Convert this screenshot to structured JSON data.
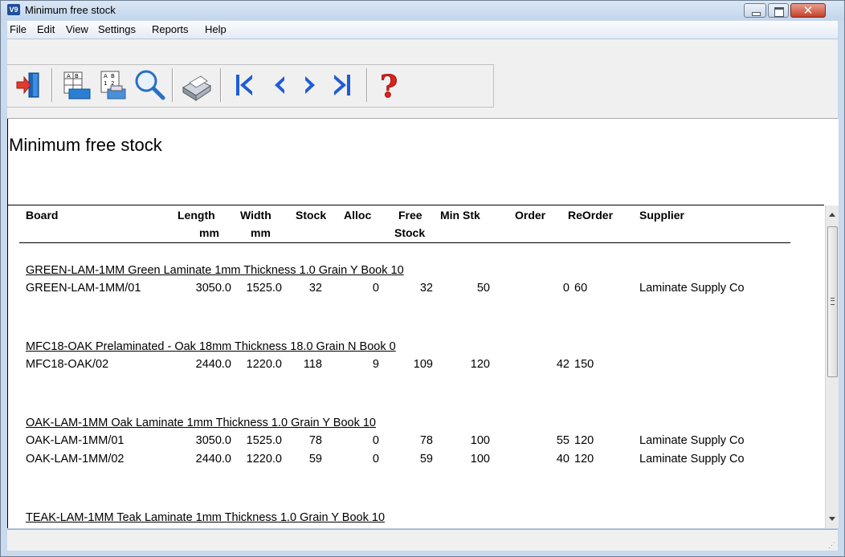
{
  "window": {
    "title": "Minimum free stock",
    "app_icon": "V9"
  },
  "menu": [
    "File",
    "Edit",
    "View",
    "Settings",
    "Reports",
    "Help"
  ],
  "toolbar_icons": [
    "exit-icon",
    "report-layout-icon",
    "print-preview-icon",
    "zoom-icon",
    "print-icon",
    "first-page-icon",
    "previous-page-icon",
    "next-page-icon",
    "last-page-icon",
    "help-icon"
  ],
  "report": {
    "title": "Minimum free stock",
    "columns": {
      "board": "Board",
      "length": "Length",
      "length_unit": "mm",
      "width": "Width",
      "width_unit": "mm",
      "stock": "Stock",
      "alloc": "Alloc",
      "free": "Free",
      "free_2": "Stock",
      "minstk": "Min Stk",
      "order": "Order",
      "reorder": "ReOrder",
      "supplier": "Supplier"
    },
    "groups": [
      {
        "heading": "GREEN-LAM-1MM Green Laminate 1mm Thickness   1.0 Grain Y Book 10",
        "rows": [
          {
            "board": "GREEN-LAM-1MM/01",
            "length": "3050.0",
            "width": "1525.0",
            "stock": "32",
            "alloc": "0",
            "free": "32",
            "minstk": "50",
            "order": "0",
            "reorder": "60",
            "supplier": "Laminate Supply Co"
          }
        ]
      },
      {
        "heading": "MFC18-OAK Prelaminated - Oak 18mm Thickness  18.0 Grain N Book 0",
        "rows": [
          {
            "board": "MFC18-OAK/02",
            "length": "2440.0",
            "width": "1220.0",
            "stock": "118",
            "alloc": "9",
            "free": "109",
            "minstk": "120",
            "order": "42",
            "reorder": "150",
            "supplier": ""
          }
        ]
      },
      {
        "heading": "OAK-LAM-1MM Oak Laminate 1mm Thickness   1.0 Grain Y Book 10",
        "rows": [
          {
            "board": "OAK-LAM-1MM/01",
            "length": "3050.0",
            "width": "1525.0",
            "stock": "78",
            "alloc": "0",
            "free": "78",
            "minstk": "100",
            "order": "55",
            "reorder": "120",
            "supplier": "Laminate Supply Co"
          },
          {
            "board": "OAK-LAM-1MM/02",
            "length": "2440.0",
            "width": "1220.0",
            "stock": "59",
            "alloc": "0",
            "free": "59",
            "minstk": "100",
            "order": "40",
            "reorder": "120",
            "supplier": "Laminate Supply Co"
          }
        ]
      },
      {
        "heading": "TEAK-LAM-1MM Teak Laminate 1mm Thickness   1.0 Grain Y Book 10",
        "rows": []
      }
    ]
  },
  "colors": {
    "titlebar": "#c3d5ec",
    "close_button": "#c4402a",
    "nav_arrows": "#1f5bd6",
    "help": "#e0201a"
  }
}
